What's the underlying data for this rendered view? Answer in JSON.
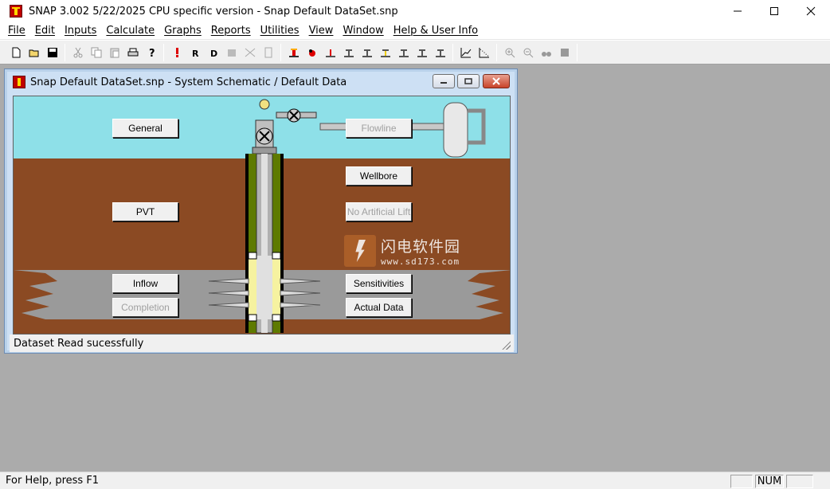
{
  "window": {
    "title": "SNAP 3.002 5/22/2025 CPU specific version - Snap Default DataSet.snp"
  },
  "menu": [
    "File",
    "Edit",
    "Inputs",
    "Calculate",
    "Graphs",
    "Reports",
    "Utilities",
    "View",
    "Window",
    "Help & User Info"
  ],
  "toolbar": {
    "groups": [
      [
        "new-icon",
        "open-icon",
        "save-icon"
      ],
      [
        "cut-icon",
        "copy-icon",
        "paste-icon",
        "print-icon",
        "help-icon"
      ],
      [
        "alert-icon",
        "report-r-icon",
        "report-d-icon",
        "report-disabled-icon",
        "schematic-disabled-icon",
        "page-disabled-icon"
      ],
      [
        "well-yellow-icon",
        "well-red-icon",
        "well-icon-3",
        "well-icon-4",
        "well-icon-5",
        "well-icon-6",
        "well-icon-7",
        "well-icon-8",
        "well-icon-9"
      ],
      [
        "plot-icon",
        "plot-dotted-icon"
      ],
      [
        "zoom-in-icon",
        "zoom-out-icon",
        "binoculars-icon",
        "stop-icon"
      ]
    ],
    "glyphs": {
      "bold_r": "R",
      "bold_d": "D"
    }
  },
  "child_window": {
    "title": "Snap Default DataSet.snp - System Schematic / Default Data",
    "status": "Dataset Read sucessfully"
  },
  "schematic_buttons": {
    "general": "General",
    "flowline": "Flowline",
    "wellbore": "Wellbore",
    "pvt": "PVT",
    "no_artificial_lift": "No Artificial Lift",
    "inflow": "Inflow",
    "sensitivities": "Sensitivities",
    "completion": "Completion",
    "actual_data": "Actual Data"
  },
  "watermark": {
    "line1": "闪电软件园",
    "line2": "www.sd173.com"
  },
  "statusbar": {
    "help": "For Help, press F1",
    "num": "NUM"
  },
  "colors": {
    "sky": "#8ee0e8",
    "earth": "#8b4a23",
    "reservoir": "#9a9a9a",
    "tubing_green": "#5e7a00",
    "perforation_yellow": "#f6f2a0"
  }
}
